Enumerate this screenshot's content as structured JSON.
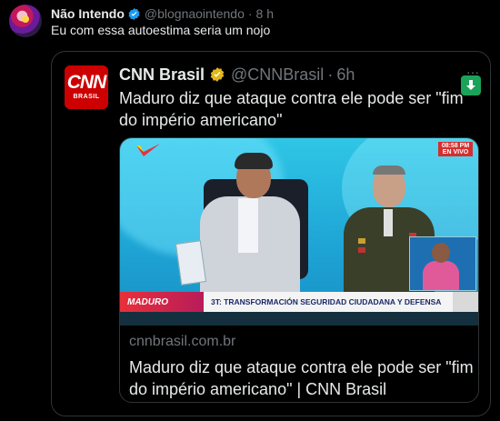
{
  "tweet": {
    "author_name": "Não Intendo",
    "handle": "@blognaointendo",
    "separator": "·",
    "time": "8 h",
    "text": "Eu com essa autoestima seria um nojo"
  },
  "quoted": {
    "author_name": "CNN Brasil",
    "handle": "@CNNBrasil",
    "separator": "·",
    "time": "6h",
    "text": "Maduro diz que ataque contra ele pode ser \"fim do império americano\"",
    "logo_big": "CNN",
    "logo_small": "BRASIL",
    "more": "···"
  },
  "card": {
    "domain": "cnnbrasil.com.br",
    "title": "Maduro diz que ataque contra ele pode ser \"fim do império americano\" | CNN Brasil",
    "image": {
      "time_top": "08:58 PM",
      "time_bottom": "EN VIVO",
      "lower_left": "MADURO",
      "lower_bar": "3T: TRANSFORMACIÓN SEGURIDAD CIUDADANA Y DEFENSA"
    }
  },
  "colors": {
    "background": "#000000",
    "verified_blue": "#1d9bf0",
    "verified_gold": "#e2b719",
    "cnn_red": "#cc0000",
    "muted": "#71767b",
    "border": "#2f3336"
  },
  "icons": [
    "verified-badge-icon",
    "gold-verified-badge-icon",
    "download-icon",
    "more-icon"
  ]
}
